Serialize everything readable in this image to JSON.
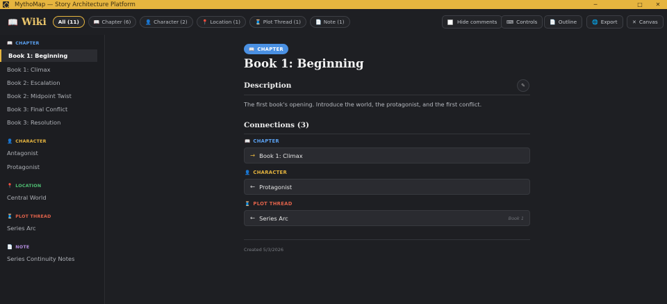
{
  "window": {
    "title": "MythoMap — Story Architecture Platform",
    "controls": [
      "─",
      "□",
      "✕"
    ]
  },
  "toolbar": {
    "title": "Wiki",
    "title_icon": "book-icon",
    "filters": [
      {
        "label": "All (11)",
        "icon": "",
        "active": true
      },
      {
        "label": "Chapter (6)",
        "icon": "📖"
      },
      {
        "label": "Character (2)",
        "icon": "👤"
      },
      {
        "label": "Location (1)",
        "icon": "📍"
      },
      {
        "label": "Plot Thread (1)",
        "icon": "🧵"
      },
      {
        "label": "Note (1)",
        "icon": "📄"
      }
    ],
    "hide_comments": "Hide comments",
    "controls": "Controls",
    "outline": "Outline",
    "export": "Export",
    "canvas": "Canvas"
  },
  "sidebar": {
    "sections": [
      {
        "label": "CHAPTER",
        "icon": "📖",
        "color": "#5aa0f0",
        "items": [
          "Book 1: Beginning",
          "Book 1: Climax",
          "Book 2: Escalation",
          "Book 2: Midpoint Twist",
          "Book 3: Final Conflict",
          "Book 3: Resolution"
        ]
      },
      {
        "label": "CHARACTER",
        "icon": "👤",
        "color": "#e6b53f",
        "items": [
          "Antagonist",
          "Protagonist"
        ]
      },
      {
        "label": "LOCATION",
        "icon": "📍",
        "color": "#4fbf73",
        "items": [
          "Central World"
        ]
      },
      {
        "label": "PLOT THREAD",
        "icon": "🧵",
        "color": "#e0624a",
        "items": [
          "Series Arc"
        ]
      },
      {
        "label": "NOTE",
        "icon": "📄",
        "color": "#b48ee0",
        "items": [
          "Series Continuity Notes"
        ]
      }
    ],
    "active_item": "Book 1: Beginning"
  },
  "main": {
    "badge": "CHAPTER",
    "badge_icon": "📖",
    "title": "Book 1: Beginning",
    "description_heading": "Description",
    "description": "The first book's opening. Introduce the world, the protagonist, and the first conflict.",
    "connections_heading": "Connections (3)",
    "connections": [
      {
        "type": "CHAPTER",
        "icon": "📖",
        "color": "#5aa0f0",
        "arrow": "→",
        "arrow_color": "#e6b53f",
        "target": "Book 1: Climax",
        "meta": ""
      },
      {
        "type": "CHARACTER",
        "icon": "👤",
        "color": "#e6b53f",
        "arrow": "←",
        "arrow_color": "#cfcfcf",
        "target": "Protagonist",
        "meta": ""
      },
      {
        "type": "PLOT THREAD",
        "icon": "🧵",
        "color": "#e0624a",
        "arrow": "←",
        "arrow_color": "#cfcfcf",
        "target": "Series Arc",
        "meta": "Book 1"
      }
    ],
    "created": "Created 5/3/2026"
  }
}
